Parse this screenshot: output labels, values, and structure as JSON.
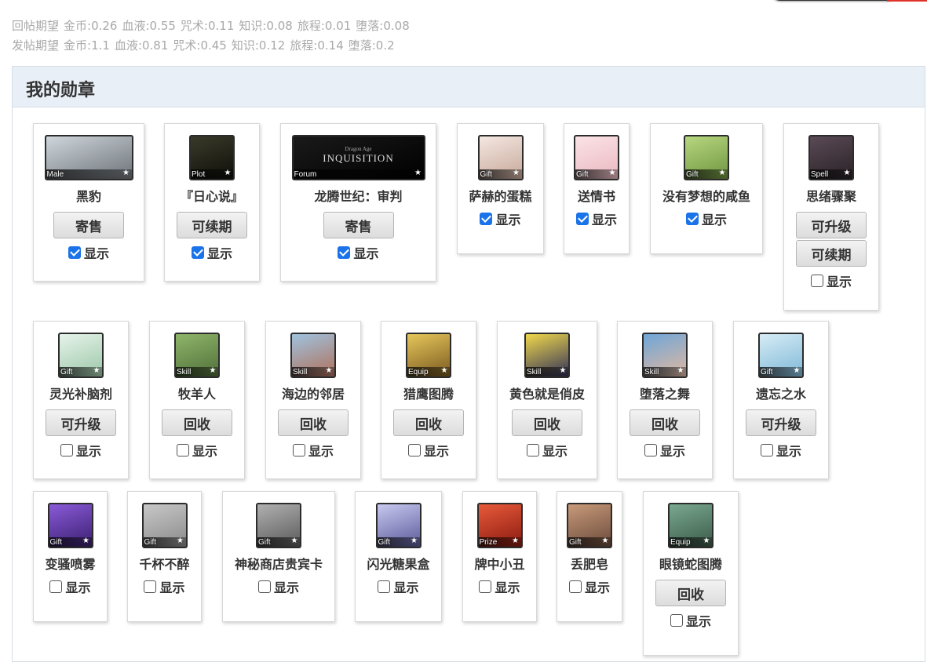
{
  "stats": {
    "reply": [
      "回帖期望",
      "金币:0.26",
      "血液:0.55",
      "咒术:0.11",
      "知识:0.08",
      "旅程:0.01",
      "堕落:0.08"
    ],
    "post": [
      "发帖期望",
      "金币:1.1",
      "血液:0.81",
      "咒术:0.45",
      "知识:0.12",
      "旅程:0.14",
      "堕落:0.2"
    ]
  },
  "panel": {
    "title": "我的勋章"
  },
  "show_label": "显示",
  "medals": [
    {
      "name": "黑豹",
      "tag": "Male",
      "buttons": [
        "寄售"
      ],
      "shown": true,
      "colors": [
        "#cfd6dc",
        "#6d7378"
      ]
    },
    {
      "name": "『日心说』",
      "tag": "Plot",
      "buttons": [
        "可续期"
      ],
      "shown": true,
      "colors": [
        "#3a3a2a",
        "#0f0f0a"
      ]
    },
    {
      "name": "龙腾世纪：审判",
      "tag": "Forum",
      "image_text": "INQUISITION",
      "image_subtext": "Dragon Age",
      "buttons": [
        "寄售"
      ],
      "shown": true,
      "colors": [
        "#1a1a1a",
        "#000000"
      ]
    },
    {
      "name": "萨赫的蛋糕",
      "tag": "Gift",
      "buttons": [],
      "shown": true,
      "colors": [
        "#f4e7e1",
        "#c7a89a"
      ]
    },
    {
      "name": "送情书",
      "tag": "Gift",
      "buttons": [],
      "shown": true,
      "colors": [
        "#fbe3e6",
        "#e9b8c0"
      ]
    },
    {
      "name": "没有梦想的咸鱼",
      "tag": "Gift",
      "buttons": [],
      "shown": true,
      "colors": [
        "#b7d77f",
        "#6f9440"
      ]
    },
    {
      "name": "思绪骤聚",
      "tag": "Spell",
      "buttons": [
        "可升级",
        "可续期"
      ],
      "shown": false,
      "colors": [
        "#5a4a55",
        "#2a2228"
      ]
    },
    {
      "name": "灵光补脑剂",
      "tag": "Gift",
      "buttons": [
        "可升级"
      ],
      "shown": false,
      "colors": [
        "#e6f3ea",
        "#9cc7a8"
      ]
    },
    {
      "name": "牧羊人",
      "tag": "Skill",
      "buttons": [
        "回收"
      ],
      "shown": false,
      "colors": [
        "#8fb56a",
        "#50703a"
      ]
    },
    {
      "name": "海边的邻居",
      "tag": "Skill",
      "buttons": [
        "回收"
      ],
      "shown": false,
      "colors": [
        "#9fc3df",
        "#b0705a"
      ]
    },
    {
      "name": "猎鹰图腾",
      "tag": "Equip",
      "buttons": [
        "回收"
      ],
      "shown": false,
      "colors": [
        "#e6c65a",
        "#7a5a20"
      ]
    },
    {
      "name": "黄色就是俏皮",
      "tag": "Skill",
      "buttons": [
        "回收"
      ],
      "shown": false,
      "colors": [
        "#f0d84a",
        "#30305a"
      ]
    },
    {
      "name": "堕落之舞",
      "tag": "Skill",
      "buttons": [
        "回收"
      ],
      "shown": false,
      "colors": [
        "#6fa6d8",
        "#e0b8a0"
      ]
    },
    {
      "name": "遗忘之水",
      "tag": "Gift",
      "buttons": [
        "可升级"
      ],
      "shown": false,
      "colors": [
        "#d6ecf5",
        "#7fb8d8"
      ]
    },
    {
      "name": "变骚喷雾",
      "tag": "Gift",
      "buttons": [],
      "shown": false,
      "colors": [
        "#8a5ad8",
        "#3a1f70"
      ]
    },
    {
      "name": "千杯不醉",
      "tag": "Gift",
      "buttons": [],
      "shown": false,
      "colors": [
        "#c8c8c8",
        "#8a8a8a"
      ]
    },
    {
      "name": "神秘商店贵宾卡",
      "tag": "Gift",
      "buttons": [],
      "shown": false,
      "colors": [
        "#b0b0b0",
        "#5a5a5a"
      ]
    },
    {
      "name": "闪光糖果盒",
      "tag": "Gift",
      "buttons": [],
      "shown": false,
      "colors": [
        "#c8c8f0",
        "#5a5a9a"
      ]
    },
    {
      "name": "牌中小丑",
      "tag": "Prize",
      "buttons": [],
      "shown": false,
      "colors": [
        "#e85a3a",
        "#8a1a10"
      ]
    },
    {
      "name": "丢肥皂",
      "tag": "Gift",
      "buttons": [],
      "shown": false,
      "colors": [
        "#c89a7a",
        "#6a4a3a"
      ]
    },
    {
      "name": "眼镜蛇图腾",
      "tag": "Equip",
      "buttons": [
        "回收"
      ],
      "shown": false,
      "colors": [
        "#7aa890",
        "#3a5a48"
      ]
    }
  ]
}
